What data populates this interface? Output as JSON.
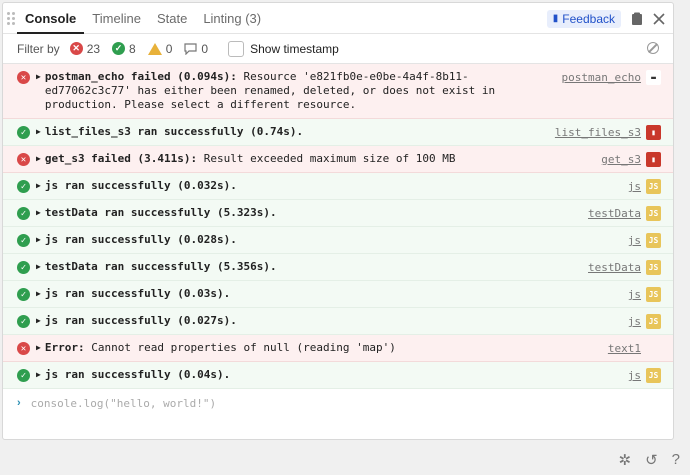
{
  "tabs": [
    {
      "label": "Console",
      "active": true
    },
    {
      "label": "Timeline",
      "active": false
    },
    {
      "label": "State",
      "active": false
    },
    {
      "label": "Linting (3)",
      "active": false
    }
  ],
  "feedback_label": "Feedback",
  "filter": {
    "label": "Filter by",
    "errors": "23",
    "success": "8",
    "warnings": "0",
    "messages": "0",
    "timestamp_label": "Show timestamp"
  },
  "logs": [
    {
      "type": "error",
      "title": "postman_echo failed (0.094s):",
      "text": " Resource 'e821fb0e-e0be-4a4f-8b11-ed77062c3c77' has either been renamed, deleted, or does not exist in production. Please select a different resource.",
      "source": "postman_echo",
      "icon": "postman-icon"
    },
    {
      "type": "success",
      "title": "list_files_s3 ran successfully (0.74s).",
      "text": "",
      "source": "list_files_s3",
      "icon": "s3-icon"
    },
    {
      "type": "error",
      "title": "get_s3 failed (3.411s):",
      "text": " Result exceeded maximum size of 100 MB",
      "source": "get_s3",
      "icon": "s3-icon"
    },
    {
      "type": "success",
      "title": "js ran successfully (0.032s).",
      "text": "",
      "source": "js",
      "icon": "js-icon"
    },
    {
      "type": "success",
      "title": "testData ran successfully (5.323s).",
      "text": "",
      "source": "testData",
      "icon": "js-icon"
    },
    {
      "type": "success",
      "title": "js ran successfully (0.028s).",
      "text": "",
      "source": "js",
      "icon": "js-icon"
    },
    {
      "type": "success",
      "title": "testData ran successfully (5.356s).",
      "text": "",
      "source": "testData",
      "icon": "js-icon"
    },
    {
      "type": "success",
      "title": "js ran successfully (0.03s).",
      "text": "",
      "source": "js",
      "icon": "js-icon"
    },
    {
      "type": "success",
      "title": "js ran successfully (0.027s).",
      "text": "",
      "source": "js",
      "icon": "js-icon"
    },
    {
      "type": "error",
      "title": "Error:",
      "text": " Cannot read properties of null (reading 'map')",
      "source": "text1",
      "icon": ""
    },
    {
      "type": "success",
      "title": "js ran successfully (0.04s).",
      "text": "",
      "source": "js",
      "icon": "js-icon"
    }
  ],
  "prompt_placeholder": "console.log(\"hello, world!\")",
  "colors": {
    "error": "#d94848",
    "success": "#2f9e4f",
    "warning": "#e8b13a",
    "accent": "#2151c9"
  }
}
